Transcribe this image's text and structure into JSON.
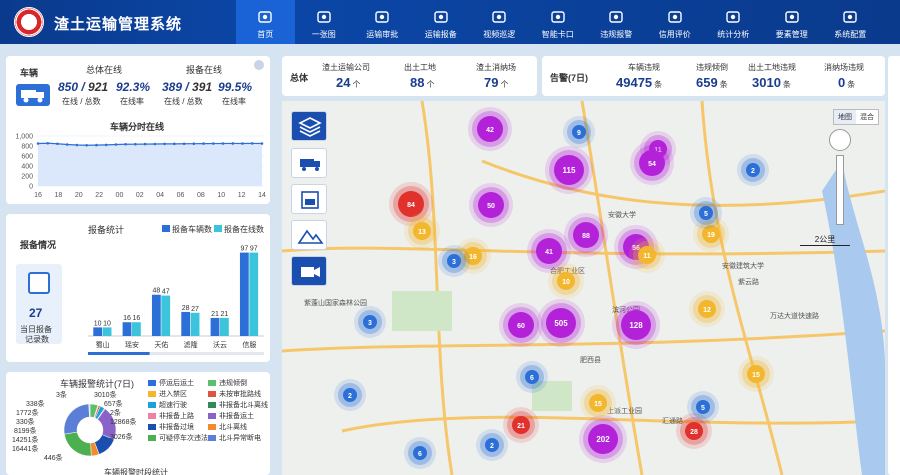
{
  "header": {
    "title": "渣土运输管理系统",
    "nav": [
      {
        "label": "首页",
        "icon": "home-icon",
        "active": true
      },
      {
        "label": "一张图",
        "icon": "map-icon"
      },
      {
        "label": "运输审批",
        "icon": "approval-icon"
      },
      {
        "label": "运输报备",
        "icon": "truck-report-icon"
      },
      {
        "label": "视频巡逻",
        "icon": "video-patrol-icon"
      },
      {
        "label": "智能卡口",
        "icon": "camera-checkpoint-icon"
      },
      {
        "label": "违规报警",
        "icon": "alarm-icon"
      },
      {
        "label": "信用评价",
        "icon": "credit-icon"
      },
      {
        "label": "统计分析",
        "icon": "stats-icon"
      },
      {
        "label": "要素管理",
        "icon": "element-icon"
      },
      {
        "label": "系统配置",
        "icon": "settings-icon"
      }
    ]
  },
  "vehicle": {
    "section": "车辆",
    "total_label": "总体在线",
    "total_online": "850",
    "total_all": "921",
    "total_rate": "92.3%",
    "report_label": "报备在线",
    "report_online": "389",
    "report_all": "391",
    "report_rate": "99.5%",
    "sub_online": "在线 / 总数",
    "sub_rate": "在线率",
    "trend_title": "车辆分时在线",
    "y_ticks": [
      "1,000",
      "800",
      "600",
      "400",
      "200",
      "0"
    ],
    "x_ticks": [
      "16",
      "18",
      "20",
      "22",
      "00",
      "02",
      "04",
      "06",
      "08",
      "10",
      "12",
      "14"
    ]
  },
  "report": {
    "section": "报备情况",
    "chart_title": "报备统计",
    "legend_vehicles": "报备车辆数",
    "legend_online": "报备在线数",
    "today_count": "27",
    "today_label1": "当日报备",
    "today_label2": "记录数"
  },
  "alarm": {
    "title": "车辆报警统计(7日)",
    "labels": [
      "3条",
      "3010条",
      "338条",
      "657条",
      "1772条",
      "2条",
      "330条",
      "12868条",
      "8199条",
      "3026条",
      "14251条",
      "16441条",
      "446条"
    ],
    "legend": [
      "停运后运土",
      "违规倾倒",
      "进入禁区",
      "未按审批路线",
      "超速行驶",
      "非报备北斗离线",
      "非报备上路",
      "非报备运土",
      "非报备过境",
      "北斗离线",
      "可疑停车次违法",
      "北斗异常断电"
    ],
    "legend_colors": [
      "#2c6fd6",
      "#5cc06a",
      "#f3b72e",
      "#e0533f",
      "#1aa3d9",
      "#2e8b57",
      "#f07ea8",
      "#8a63c9",
      "#1a4fb0",
      "#f28b2e",
      "#4caf50",
      "#5b7fd6"
    ],
    "footer": "车辆报警时段统计"
  },
  "summary": {
    "label": "总体",
    "companies_label": "渣土运输公司",
    "companies": "24",
    "sites_label": "出土工地",
    "sites": "88",
    "disposal_label": "渣土消纳场",
    "disposal": "79",
    "unit": "个"
  },
  "alarm_summary": {
    "label": "告警(7日)",
    "vehicle_label": "车辆违规",
    "vehicle": "49475",
    "dump_label": "违规倾倒",
    "dump": "659",
    "site_label": "出土工地违规",
    "site": "3010",
    "disposal_label": "消纳场违规",
    "disposal": "0",
    "unit": "条"
  },
  "map": {
    "type_options": [
      "地图",
      "混合"
    ],
    "scale": "2公里",
    "places": [
      "肥西县",
      "紫云路",
      "万达大道快速路",
      "合肥工业区",
      "安徽建筑大学",
      "紫蓬山国家森林公园",
      "滨河公园",
      "安徽大学",
      "上派工业园",
      "汇通路"
    ],
    "clusters": [
      {
        "n": "42",
        "c": "#b322d9"
      },
      {
        "n": "9",
        "c": "#2c6fd6"
      },
      {
        "n": "11",
        "c": "#b322d9"
      },
      {
        "n": "54",
        "c": "#b322d9"
      },
      {
        "n": "115",
        "c": "#b322d9"
      },
      {
        "n": "2",
        "c": "#2c6fd6"
      },
      {
        "n": "50",
        "c": "#b322d9"
      },
      {
        "n": "84",
        "c": "#e0312d"
      },
      {
        "n": "13",
        "c": "#f3b72e"
      },
      {
        "n": "41",
        "c": "#b322d9"
      },
      {
        "n": "88",
        "c": "#b322d9"
      },
      {
        "n": "56",
        "c": "#b322d9"
      },
      {
        "n": "11",
        "c": "#f3b72e"
      },
      {
        "n": "19",
        "c": "#f3b72e"
      },
      {
        "n": "5",
        "c": "#2c6fd6"
      },
      {
        "n": "16",
        "c": "#f3b72e"
      },
      {
        "n": "3",
        "c": "#2c6fd6"
      },
      {
        "n": "10",
        "c": "#f3b72e"
      },
      {
        "n": "12",
        "c": "#f3b72e"
      },
      {
        "n": "60",
        "c": "#b322d9"
      },
      {
        "n": "505",
        "c": "#b322d9"
      },
      {
        "n": "128",
        "c": "#b322d9"
      },
      {
        "n": "3",
        "c": "#2c6fd6"
      },
      {
        "n": "2",
        "c": "#2c6fd6"
      },
      {
        "n": "15",
        "c": "#f3b72e"
      },
      {
        "n": "21",
        "c": "#e0312d"
      },
      {
        "n": "202",
        "c": "#b322d9"
      },
      {
        "n": "28",
        "c": "#e0312d"
      },
      {
        "n": "15",
        "c": "#f3b72e"
      },
      {
        "n": "5",
        "c": "#2c6fd6"
      },
      {
        "n": "6",
        "c": "#2c6fd6"
      },
      {
        "n": "2",
        "c": "#2c6fd6"
      },
      {
        "n": "6",
        "c": "#2c6fd6"
      }
    ]
  },
  "chart_data": [
    {
      "type": "line",
      "title": "车辆分时在线",
      "x": [
        "16",
        "17",
        "18",
        "19",
        "20",
        "21",
        "22",
        "23",
        "00",
        "01",
        "02",
        "03",
        "04",
        "05",
        "06",
        "07",
        "08",
        "09",
        "10",
        "11",
        "12",
        "13",
        "14",
        "15"
      ],
      "values": [
        850,
        855,
        845,
        830,
        820,
        815,
        818,
        822,
        830,
        835,
        836,
        838,
        840,
        842,
        843,
        845,
        846,
        848,
        849,
        850,
        851,
        850,
        852,
        850
      ],
      "ylim": [
        0,
        1000
      ]
    },
    {
      "type": "bar",
      "title": "报备统计",
      "categories": [
        "蜀山",
        "瑶安",
        "天佑",
        "滤隆",
        "沃云",
        "信服"
      ],
      "series": [
        {
          "name": "报备车辆数",
          "values": [
            10,
            16,
            48,
            28,
            21,
            97
          ]
        },
        {
          "name": "报备在线数",
          "values": [
            10,
            16,
            47,
            27,
            21,
            97
          ]
        }
      ],
      "ylim": [
        0,
        100
      ]
    },
    {
      "type": "pie",
      "title": "车辆报警统计(7日)",
      "slices": [
        {
          "label": "3条",
          "value": 3
        },
        {
          "label": "3010条",
          "value": 3010
        },
        {
          "label": "338条",
          "value": 338
        },
        {
          "label": "657条",
          "value": 657
        },
        {
          "label": "1772条",
          "value": 1772
        },
        {
          "label": "2条",
          "value": 2
        },
        {
          "label": "330条",
          "value": 330
        },
        {
          "label": "12868条",
          "value": 12868
        },
        {
          "label": "8199条",
          "value": 8199
        },
        {
          "label": "3026条",
          "value": 3026
        },
        {
          "label": "14251条",
          "value": 14251
        },
        {
          "label": "16441条",
          "value": 16441
        },
        {
          "label": "446条",
          "value": 446
        }
      ]
    }
  ]
}
